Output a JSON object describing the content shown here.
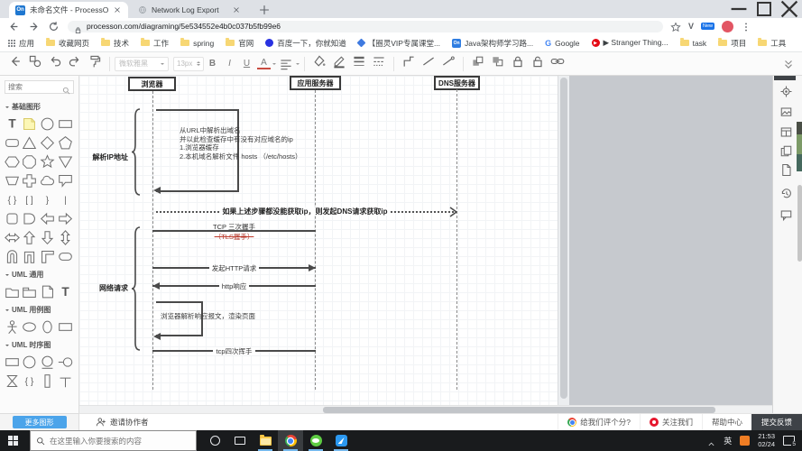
{
  "colors": {
    "accent_blue": "#4ba4ea",
    "feedback_dark": "#3e4247",
    "taskbar_dark": "#191b1d",
    "diagram_line": "#4a4a4a",
    "red_strikethrough": "#c0392b",
    "folder_yellow": "#f7d774"
  },
  "browser": {
    "tabs": [
      {
        "title": "未命名文件 - ProcessOn"
      },
      {
        "title": "Network Log Export"
      }
    ],
    "url": "processon.com/diagraming/5e534552e4b0c037b5fb99e6",
    "extension_badge": "New",
    "bookmarks": [
      {
        "label": "应用",
        "icon": "grid"
      },
      {
        "label": "收藏网页",
        "icon": "folder"
      },
      {
        "label": "技术",
        "icon": "folder"
      },
      {
        "label": "工作",
        "icon": "folder"
      },
      {
        "label": "spring",
        "icon": "folder"
      },
      {
        "label": "官网",
        "icon": "folder"
      },
      {
        "label": "百度一下，你就知道",
        "icon": "baidu"
      },
      {
        "label": "【圈灵VIP专属课堂...",
        "icon": "gem"
      },
      {
        "label": "Java架构师学习路...",
        "icon": "on"
      },
      {
        "label": "Google",
        "icon": "google"
      },
      {
        "label": "▶ Stranger Thing...",
        "icon": "play"
      },
      {
        "label": "task",
        "icon": "folder"
      },
      {
        "label": "项目",
        "icon": "folder"
      },
      {
        "label": "工具",
        "icon": "folder"
      }
    ]
  },
  "editor_toolbar": {
    "font_family": "微软雅黑",
    "font_size": "13px",
    "bold": "B",
    "italic": "I",
    "underline": "U",
    "font_color": "A",
    "left_icons": [
      "nav-back",
      "shape-library",
      "undo",
      "redo",
      "format-painter"
    ],
    "style_icons": [
      "fill-color",
      "line-color",
      "line-width",
      "line-style"
    ],
    "connector_icons": [
      "connector-style",
      "line-straight",
      "line-arrow"
    ],
    "arrange_icons": [
      "bring-front",
      "send-back",
      "lock",
      "unlock",
      "hyperlink"
    ]
  },
  "shape_panel": {
    "search_placeholder": "搜索",
    "more_shapes": "更多图形",
    "sections": [
      {
        "title": "基础图形",
        "shapes": [
          "text",
          "sticky-note",
          "circle",
          "rect",
          "rounded-rect",
          "triangle",
          "diamond",
          "pentagon",
          "hexagon",
          "octagon",
          "star",
          "inverted-triangle",
          "trapezoid",
          "cross",
          "cloud",
          "callout",
          "brace-pair",
          "bracket-pair",
          "brace-right",
          "bar",
          "rounded-square",
          "d-shape",
          "arrow-left",
          "arrow-right",
          "arrow-left-right",
          "arrow-up",
          "arrow-down",
          "arrow-up-down",
          "arch",
          "arch-square",
          "corner-l",
          "rounded-rect-wide"
        ]
      },
      {
        "title": "UML 通用",
        "shapes": [
          "package",
          "package-tab",
          "note",
          "text"
        ]
      },
      {
        "title": "UML 用例图",
        "shapes": [
          "actor",
          "ellipse",
          "oval",
          "rect"
        ]
      },
      {
        "title": "UML 时序图",
        "shapes": [
          "rect",
          "circle",
          "circle-underline",
          "lifeline-head",
          "hourglass",
          "brace-pair",
          "activation",
          "t-bar"
        ]
      }
    ]
  },
  "diagram": {
    "actors": [
      "浏览器",
      "应用服务器",
      "DNS服务器"
    ],
    "group_labels": [
      "解析IP地址",
      "网络请求"
    ],
    "note_lines": [
      "从URL中解析出域名",
      "并以此检查缓存中有没有对应域名的ip",
      "1.浏览器缓存",
      "2.本机域名解析文件 hosts （/etc/hosts）"
    ],
    "dns_condition": "如果上述步骤都没能获取ip，则发起DNS请求获取ip",
    "messages": [
      {
        "label": "TCP 三次握手"
      },
      {
        "label": "（TLS握手）",
        "style": "red-strikethrough"
      },
      {
        "label": "发起HTTP请求"
      },
      {
        "label": "http响应"
      },
      {
        "label": "浏览器解析响应报文，渲染页面"
      },
      {
        "label": "tcp四次挥手"
      }
    ]
  },
  "statusbar": {
    "invite": "邀请协作者",
    "rate_us": "给我们评个分?",
    "follow_us": "关注我们",
    "help_center": "帮助中心",
    "feedback": "提交反馈"
  },
  "taskbar": {
    "search_placeholder": "在这里输入你要搜索的内容",
    "ime": "英",
    "time": "21:53",
    "date": "02/24",
    "notification_count": "5"
  }
}
